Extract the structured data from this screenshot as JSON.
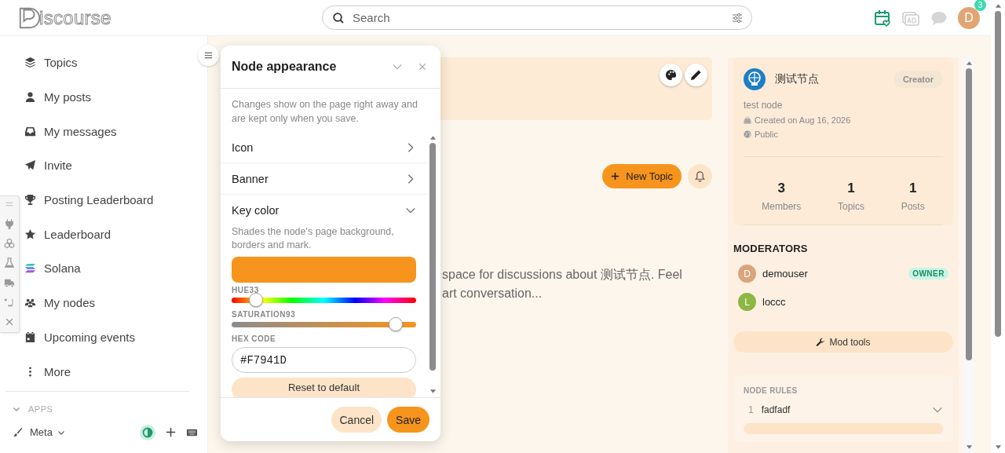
{
  "header": {
    "logo_text": "iscourse",
    "search": {
      "placeholder": "Search"
    },
    "avatar": {
      "initial": "D",
      "badge": "3"
    }
  },
  "sidebar": {
    "items": [
      {
        "label": "Topics"
      },
      {
        "label": "My posts"
      },
      {
        "label": "My messages"
      },
      {
        "label": "Invite"
      },
      {
        "label": "Posting Leaderboard"
      },
      {
        "label": "Leaderboard"
      },
      {
        "label": "Solana"
      },
      {
        "label": "My nodes"
      },
      {
        "label": "Upcoming events"
      },
      {
        "label": "More"
      }
    ],
    "section": {
      "title": "APPS",
      "expanded": true
    },
    "apps_item": {
      "label": "Meta"
    }
  },
  "popup": {
    "title": "Node appearance",
    "intro": "Changes show on the page right away and are kept only when you save.",
    "sections": [
      {
        "label": "Icon",
        "expanded": false
      },
      {
        "label": "Banner",
        "expanded": false
      },
      {
        "label": "Key color",
        "expanded": true
      }
    ],
    "key_color": {
      "description": "Shades the node's page background, borders and mark.",
      "hue": {
        "label": "HUE",
        "value": "33",
        "level": 0.092
      },
      "saturation": {
        "label": "SATURATION",
        "value": "93",
        "level": 0.93
      },
      "hex_label": "HEX CODE",
      "hex_value": "#F7941D",
      "reset": "Reset to default"
    },
    "buttons": {
      "cancel": "Cancel",
      "save": "Save"
    }
  },
  "main": {
    "new_topic": "New Topic",
    "description_lines": [
      "space for discussions about 测试节点. Feel",
      "art conversation..."
    ]
  },
  "node_card": {
    "name": "测试节点",
    "role": "Creator",
    "subtitle": "test node",
    "created": "Created on Aug 16, 2026",
    "visibility": "Public",
    "stats": [
      {
        "value": "3",
        "label": "Members"
      },
      {
        "value": "1",
        "label": "Topics"
      },
      {
        "value": "1",
        "label": "Posts"
      }
    ],
    "moderators_title": "MODERATORS",
    "moderators": [
      {
        "initial": "D",
        "name": "demouser",
        "badge": "OWNER",
        "color": "#dba47c"
      },
      {
        "initial": "L",
        "name": "loccc",
        "color": "#8cb744"
      }
    ],
    "mod_tools": "Mod tools",
    "rules": {
      "title": "NODE RULES",
      "items": [
        {
          "number": "1",
          "text": "fadfadf",
          "expanded": false
        }
      ]
    }
  }
}
